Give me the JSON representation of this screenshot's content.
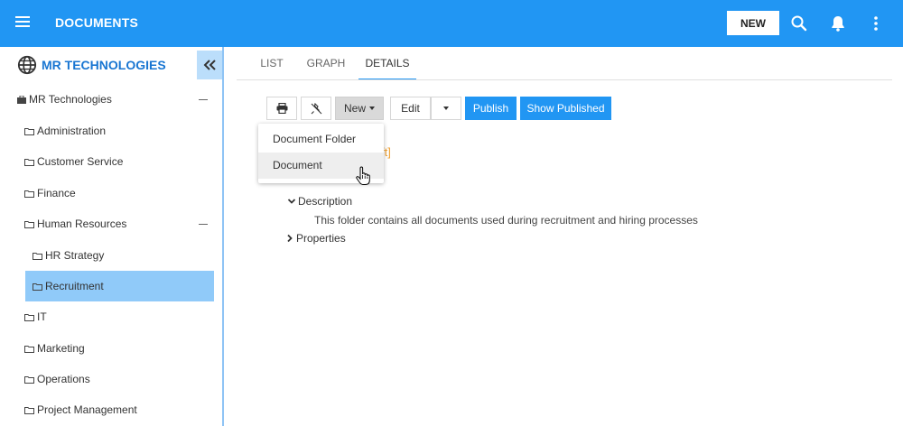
{
  "header": {
    "title": "DOCUMENTS",
    "new_label": "NEW",
    "accent": "#2196f3"
  },
  "sidebar": {
    "brand": "MR TECHNOLOGIES",
    "items": [
      {
        "label": "MR Technologies"
      },
      {
        "label": "Administration"
      },
      {
        "label": "Customer Service"
      },
      {
        "label": "Finance"
      },
      {
        "label": "Human Resources"
      },
      {
        "label": "HR Strategy"
      },
      {
        "label": "Recruitment"
      },
      {
        "label": "IT"
      },
      {
        "label": "Marketing"
      },
      {
        "label": "Operations"
      },
      {
        "label": "Project Management"
      }
    ],
    "selected": "Recruitment"
  },
  "tabs": [
    {
      "label": "LIST"
    },
    {
      "label": "GRAPH"
    },
    {
      "label": "DETAILS"
    }
  ],
  "active_tab": "DETAILS",
  "toolbar": {
    "new_label": "New",
    "edit_label": "Edit",
    "publish_label": "Publish",
    "show_published_label": "Show Published"
  },
  "new_menu": {
    "items": [
      {
        "label": "Document Folder"
      },
      {
        "label": "Document"
      }
    ],
    "hovered": "Document"
  },
  "details": {
    "draft_tag": "ft]",
    "description_label": "Description",
    "description_text": "This folder contains all documents used during recruitment and hiring processes",
    "properties_label": "Properties"
  },
  "icons": {
    "menu": "hamburger-icon",
    "search": "search-icon",
    "notifications": "bell-icon",
    "more": "kebab-icon",
    "collapse": "double-chevron-left-icon",
    "print": "printer-icon",
    "unpin": "unpin-icon",
    "folder": "folder-icon",
    "briefcase": "briefcase-icon",
    "globe": "globe-icon"
  }
}
